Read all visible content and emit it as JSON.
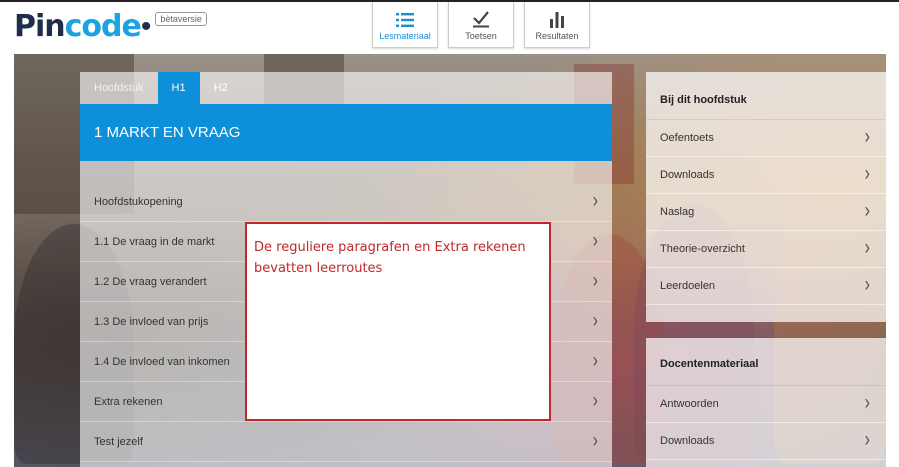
{
  "logo": {
    "brand_part1": "Pin",
    "brand_part2": "code",
    "dot": "•",
    "badge": "bètaversie"
  },
  "nav": [
    {
      "label": "Lesmateriaal",
      "icon": "list-icon",
      "active": true
    },
    {
      "label": "Toetsen",
      "icon": "check-icon",
      "active": false
    },
    {
      "label": "Resultaten",
      "icon": "bar-chart-icon",
      "active": false
    }
  ],
  "chapter_tabs": [
    "Hoofdstuk",
    "H1",
    "H2"
  ],
  "chapter_title": "1 MARKT EN VRAAG",
  "items": [
    "Hoofdstukopening",
    "1.1 De vraag in de markt",
    "1.2 De vraag verandert",
    "1.3 De invloed van prijs",
    "1.4 De invloed van inkomen",
    "Extra rekenen",
    "Test jezelf"
  ],
  "note": {
    "line1": "De reguliere paragrafen en Extra rekenen",
    "line2": "bevatten leerroutes"
  },
  "side_panel": {
    "title": "Bij dit hoofdstuk",
    "items": [
      "Oefentoets",
      "Downloads",
      "Naslag",
      "Theorie-overzicht",
      "Leerdoelen"
    ]
  },
  "teacher_panel": {
    "title": "Docentenmateriaal",
    "items": [
      "Antwoorden",
      "Downloads"
    ]
  },
  "chevron": "›",
  "colors": {
    "accent": "#0d8fd9",
    "note_red": "#c0282a",
    "brand_dark": "#1f2d4a",
    "brand_light": "#1aa3e0"
  }
}
